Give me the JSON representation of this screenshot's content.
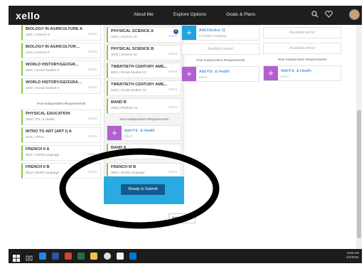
{
  "nav": {
    "logo": "xello",
    "links": [
      "About Me",
      "Explore Options",
      "Goals & Plans"
    ],
    "icons": [
      "search-icon",
      "heart-icon",
      "avatar"
    ]
  },
  "col_a": {
    "courses": [
      {
        "title": "BIOLOGY IN AGRICULTURE A",
        "sub": "1101 | Science 9",
        "credits": "0.5 cr."
      },
      {
        "title": "BIOLOGY IN AGRICULTURE B",
        "sub": "1102 | Science 9",
        "credits": "0.5 cr."
      },
      {
        "title": "WORLD HISTORY/GEOGR...",
        "sub": "5201 | Social Studies 9",
        "credits": "0.5 cr."
      },
      {
        "title": "WORLD HISTORY/GEOGRAP...",
        "sub": "5202 | Social Studies 9",
        "credits": "0.5 cr."
      }
    ],
    "year_head": "Year-Independent Requirements",
    "year_courses": [
      {
        "title": "PHYSICAL EDUCATION",
        "sub": "2552 | P.E. & Health",
        "credits": "0.5 cr."
      },
      {
        "title": "INTRO TO ART (ART I) A",
        "sub": "2101 | VPAA",
        "credits": "0.5 cr."
      },
      {
        "title": "FRENCH II A",
        "sub": "3911 | World Language",
        "credits": "0.5 cr."
      },
      {
        "title": "FRENCH II B",
        "sub": "3912 | World Language",
        "credits": "0.5 cr."
      }
    ]
  },
  "col_b": {
    "courses": [
      {
        "title": "PHYSICAL SCIENCE A",
        "sub": "1001 | Science 10",
        "credits": "0.5 cr.",
        "info": "i"
      },
      {
        "title": "PHYSICAL SCIENCE B",
        "sub": "1002 | Science 10",
        "credits": "0.5 cr."
      },
      {
        "title": "TWENTIETH CENTURY AME...",
        "sub": "5251 | Social Studies 10",
        "credits": "0.5 cr."
      },
      {
        "title": "TWENTIETH CENTURY AME...",
        "sub": "5252 | Social Studies 10",
        "credits": "0.5 cr."
      },
      {
        "title": "BAND B",
        "sub": "2902 | Platform 10",
        "credits": "0.5 cr."
      }
    ],
    "year_head": "Year-Independent Requirements",
    "add_pe": {
      "label": "Add P.E. & Health",
      "sub": "0.5 cr."
    },
    "year_courses": [
      {
        "title": "BAND A",
        "sub": "2901 | VPAA",
        "credits": "0.5 cr."
      },
      {
        "title": "FRENCH III B",
        "sub": "3932 | World Language",
        "credits": "0.5 cr."
      }
    ],
    "submit": "Ready to Submit"
  },
  "col_c": {
    "add_elective": {
      "label": "Add Elective 11",
      "sub": "6 Credits remaining"
    },
    "available": "Available period",
    "year_head": "Year-Independent Requirements",
    "add_pe": {
      "label": "Add P.E. & Health",
      "sub": "0.5 cr."
    }
  },
  "col_d": {
    "available1": "Available period",
    "available2": "Available period",
    "year_head": "Year-Independent Requirements",
    "add_pe": {
      "label": "Add P.E. & Health",
      "sub": "0.5 cr."
    }
  },
  "add_grade": "Add Grade 1",
  "taskbar": {
    "time": "9:59 AM",
    "date": "2/4/2021"
  }
}
